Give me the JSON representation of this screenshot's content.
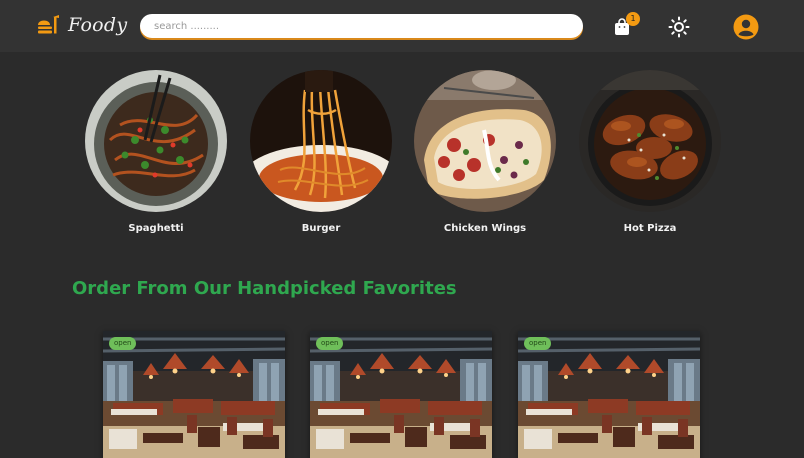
{
  "app": {
    "name": "Foody",
    "accent_color": "#f39a12",
    "heading_color": "#2fa84f"
  },
  "header": {
    "logo_icon": "burger-stack-icon",
    "search": {
      "placeholder": "search .........",
      "value": ""
    },
    "cart": {
      "icon": "shopping-bag-icon",
      "count": "1"
    },
    "theme_icon": "sun-icon",
    "profile_icon": "user-circle-icon"
  },
  "categories": [
    {
      "label": "Spaghetti"
    },
    {
      "label": "Burger"
    },
    {
      "label": "Chicken Wings"
    },
    {
      "label": "Hot Pizza"
    }
  ],
  "section": {
    "title": "Order From Our Handpicked Favorites"
  },
  "restaurants": [
    {
      "status": "open"
    },
    {
      "status": "open"
    },
    {
      "status": "open"
    }
  ]
}
